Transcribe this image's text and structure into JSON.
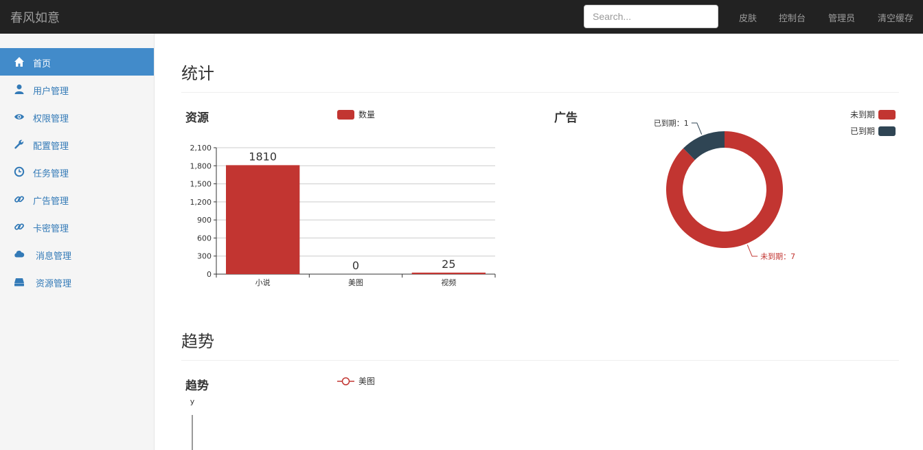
{
  "brand": "春风如意",
  "search": {
    "placeholder": "Search..."
  },
  "topnav": [
    "皮肤",
    "控制台",
    "管理员",
    "清空缓存"
  ],
  "sidebar": {
    "items": [
      {
        "label": "首页",
        "icon": "home-icon",
        "active": true
      },
      {
        "label": "用户管理",
        "icon": "user-icon"
      },
      {
        "label": "权限管理",
        "icon": "eye-icon"
      },
      {
        "label": "配置管理",
        "icon": "wrench-icon"
      },
      {
        "label": "任务管理",
        "icon": "clock-icon"
      },
      {
        "label": "广告管理",
        "icon": "link-icon"
      },
      {
        "label": "卡密管理",
        "icon": "link-icon"
      },
      {
        "label": "消息管理",
        "icon": "cloud-icon"
      },
      {
        "label": "资源管理",
        "icon": "drive-icon"
      }
    ]
  },
  "sections": {
    "stats": "统计",
    "trend": "趋势"
  },
  "colors": {
    "red": "#c23531",
    "navy": "#2f4554",
    "accent": "#428bca"
  },
  "chart_data": [
    {
      "type": "bar",
      "title": "资源",
      "categories": [
        "小说",
        "美图",
        "视频"
      ],
      "series": [
        {
          "name": "数量",
          "values": [
            1810,
            0,
            25
          ]
        }
      ],
      "yticks": [
        "0",
        "300",
        "600",
        "900",
        "1,200",
        "1,500",
        "1,800",
        "2,100"
      ],
      "ylim": [
        0,
        2100
      ],
      "grid": true,
      "legend": "top-center"
    },
    {
      "type": "pie",
      "title": "广告",
      "slices": [
        {
          "name": "未到期",
          "value": 7,
          "label": "未到期：7"
        },
        {
          "name": "已到期",
          "value": 1,
          "label": "已到期：1"
        }
      ],
      "legend": "top-right"
    },
    {
      "type": "line",
      "title": "趋势",
      "series": [
        {
          "name": "美图",
          "values": []
        }
      ],
      "ylabel": "y",
      "legend": "top-center"
    }
  ]
}
